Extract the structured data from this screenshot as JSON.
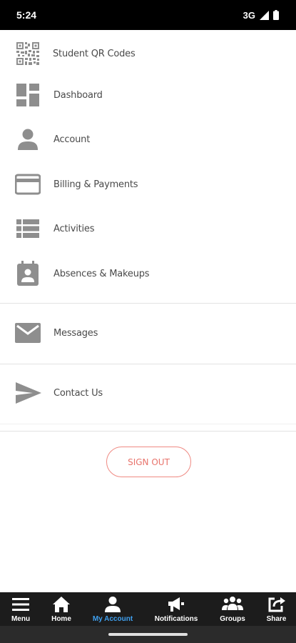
{
  "status_bar": {
    "time": "5:24",
    "network": "3G"
  },
  "menu": {
    "items": [
      {
        "label": "Student QR Codes",
        "icon": "qr-code-icon"
      },
      {
        "label": "Dashboard",
        "icon": "dashboard-icon"
      },
      {
        "label": "Account",
        "icon": "person-icon"
      },
      {
        "label": "Billing & Payments",
        "icon": "credit-card-icon"
      },
      {
        "label": "Activities",
        "icon": "list-icon"
      },
      {
        "label": "Absences & Makeups",
        "icon": "calendar-person-icon"
      },
      {
        "label": "Messages",
        "icon": "mail-icon"
      },
      {
        "label": "Contact Us",
        "icon": "send-icon"
      }
    ]
  },
  "sign_out": {
    "label": "SIGN OUT"
  },
  "tabbar": {
    "tabs": [
      {
        "label": "Menu",
        "icon": "hamburger-icon",
        "active": false
      },
      {
        "label": "Home",
        "icon": "home-icon",
        "active": false
      },
      {
        "label": "My Account",
        "icon": "account-icon",
        "active": true
      },
      {
        "label": "Notifications",
        "icon": "megaphone-icon",
        "active": false
      },
      {
        "label": "Groups",
        "icon": "groups-icon",
        "active": false
      },
      {
        "label": "Share",
        "icon": "share-icon",
        "active": false
      }
    ]
  },
  "colors": {
    "icon_gray": "#8e8e8e",
    "accent_blue": "#3fa0ef",
    "signout_red": "#e8736b",
    "tabbar_bg": "#1c1c1c"
  }
}
